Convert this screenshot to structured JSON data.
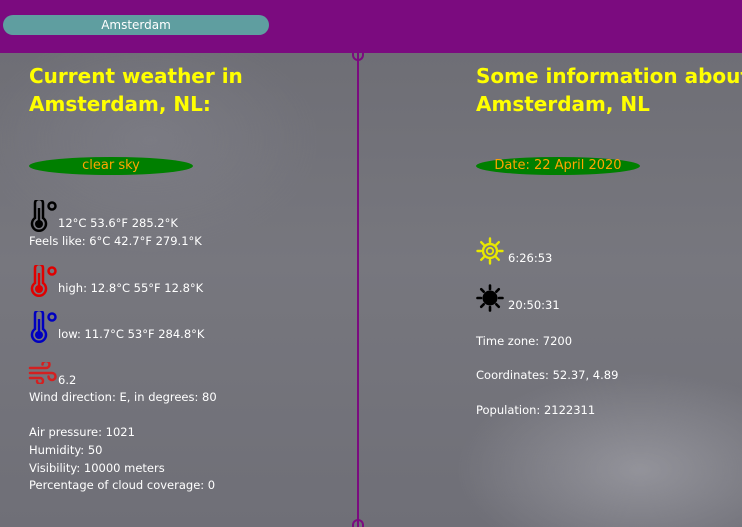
{
  "search": {
    "value": "Amsterdam"
  },
  "left": {
    "heading_line1": "Current weather in",
    "heading_line2": "Amsterdam, NL:",
    "condition": "clear sky",
    "temp": "12°C   53.6°F   285.2°K",
    "feels_like": "Feels like:  6°C  42.7°F   279.1°K",
    "high": "high: 12.8°C    55°F   12.8°K",
    "low": "low: 11.7°C   53°F   284.8°K",
    "wind_speed": "6.2",
    "wind_direction": "Wind direction: E, in degrees: 80",
    "air_pressure": "Air pressure: 1021",
    "humidity": "Humidity: 50",
    "visibility": "Visibility: 10000 meters",
    "cloud_coverage": "Percentage of cloud coverage: 0"
  },
  "right": {
    "heading_line1": "Some information about",
    "heading_line2": "Amsterdam, NL",
    "date": "Date: 22 April 2020",
    "sunrise": "6:26:53",
    "sunset": "20:50:31",
    "timezone": "Time zone: 7200",
    "coordinates": "Coordinates: 52.37, 4.89",
    "population": "Population: 2122311"
  },
  "colors": {
    "bar": "#7b0b7f",
    "heading": "#ffff00",
    "pill_bg": "#007f00",
    "pill_text": "#ffa500",
    "search_bg": "#5f9ea0"
  },
  "icons": {
    "temp": "thermometer-black-icon",
    "high": "thermometer-red-icon",
    "low": "thermometer-blue-icon",
    "wind": "wind-icon",
    "sunrise": "sun-outline-icon",
    "sunset": "sun-filled-icon"
  }
}
